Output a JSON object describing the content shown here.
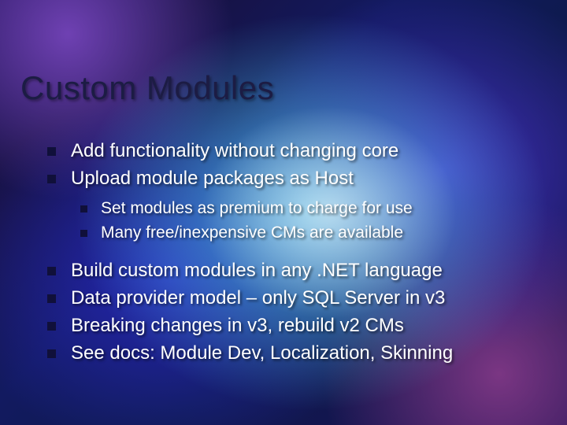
{
  "title": "Custom Modules",
  "bullets": {
    "group1": [
      "Add functionality without changing core",
      "Upload module packages as Host"
    ],
    "sub": [
      "Set modules as premium to charge for use",
      "Many free/inexpensive CMs are available"
    ],
    "group2": [
      "Build custom modules in any .NET language",
      "Data provider model – only SQL Server in v3",
      "Breaking changes in v3, rebuild v2 CMs",
      "See docs: Module Dev, Localization, Skinning"
    ]
  }
}
